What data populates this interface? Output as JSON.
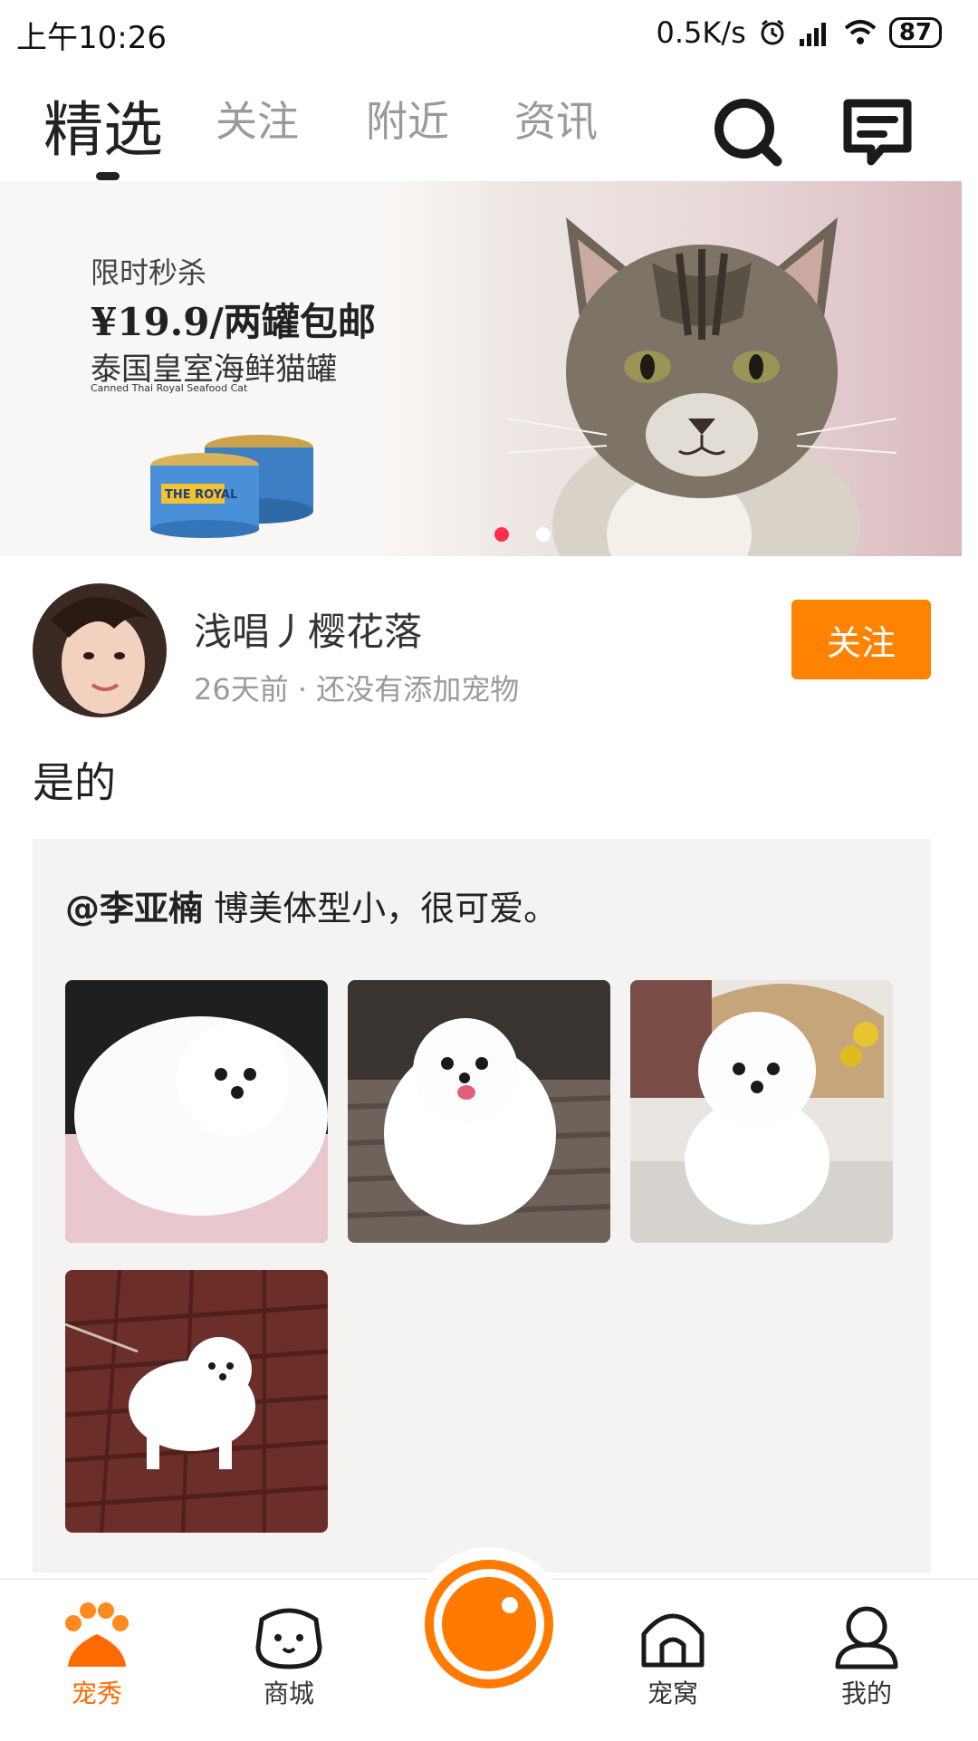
{
  "status_bar": {
    "time": "上午10:26",
    "net_speed": "0.5K/s",
    "battery": "87"
  },
  "top_nav": {
    "tabs": [
      {
        "label": "精选",
        "active": true
      },
      {
        "label": "关注",
        "active": false
      },
      {
        "label": "附近",
        "active": false
      },
      {
        "label": "资讯",
        "active": false
      }
    ],
    "icons": [
      "search-icon",
      "message-icon"
    ]
  },
  "banner": {
    "line1": "限时秒杀",
    "line2": "¥19.9/两罐包邮",
    "line3": "泰国皇室海鲜猫罐",
    "line4": "Canned Thai Royal Seafood Cat",
    "can_label": "THE ROYAL",
    "dots": 2,
    "active_dot": 0
  },
  "post": {
    "username": "浅唱丿樱花落",
    "meta": "26天前 · 还没有添加宠物",
    "follow_label": "关注",
    "text": "是的",
    "quote": {
      "mention": "@李亚楠",
      "text": " 博美体型小，很可爱。"
    }
  },
  "bottom_nav": {
    "items": [
      {
        "label": "宠秀",
        "active": true
      },
      {
        "label": "商城",
        "active": false
      },
      {
        "label": "宠窝",
        "active": false
      },
      {
        "label": "我的",
        "active": false
      }
    ]
  },
  "colors": {
    "accent": "#ff8200",
    "active_dot": "#ff2d4b",
    "quote_bg": "#f4f3f2"
  }
}
